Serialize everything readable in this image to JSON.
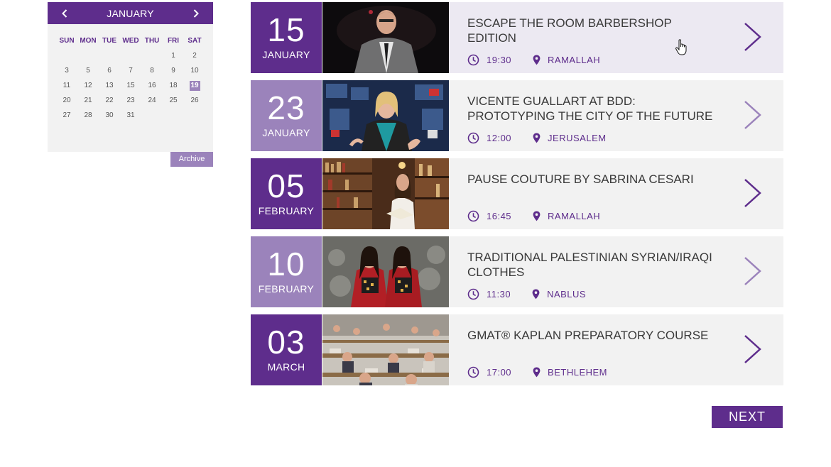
{
  "calendar": {
    "month": "JANUARY",
    "weekdays": [
      "SUN",
      "MON",
      "TUE",
      "WED",
      "THU",
      "FRI",
      "SAT"
    ],
    "days": [
      {
        "d": "",
        "t": ""
      },
      {
        "d": "",
        "t": ""
      },
      {
        "d": "",
        "t": ""
      },
      {
        "d": "",
        "t": ""
      },
      {
        "d": "",
        "t": ""
      },
      {
        "d": "1",
        "t": ""
      },
      {
        "d": "2",
        "t": ""
      },
      {
        "d": "3",
        "t": ""
      },
      {
        "d": "4",
        "t": "event"
      },
      {
        "d": "5",
        "t": ""
      },
      {
        "d": "6",
        "t": ""
      },
      {
        "d": "7",
        "t": ""
      },
      {
        "d": "8",
        "t": ""
      },
      {
        "d": "9",
        "t": ""
      },
      {
        "d": "10",
        "t": ""
      },
      {
        "d": "11",
        "t": ""
      },
      {
        "d": "12",
        "t": ""
      },
      {
        "d": "13",
        "t": ""
      },
      {
        "d": "14",
        "t": "event"
      },
      {
        "d": "15",
        "t": ""
      },
      {
        "d": "16",
        "t": ""
      },
      {
        "d": "17",
        "t": "event"
      },
      {
        "d": "18",
        "t": ""
      },
      {
        "d": "19",
        "t": "today"
      },
      {
        "d": "20",
        "t": ""
      },
      {
        "d": "21",
        "t": ""
      },
      {
        "d": "22",
        "t": ""
      },
      {
        "d": "23",
        "t": ""
      },
      {
        "d": "24",
        "t": ""
      },
      {
        "d": "25",
        "t": ""
      },
      {
        "d": "26",
        "t": ""
      },
      {
        "d": "27",
        "t": ""
      },
      {
        "d": "28",
        "t": ""
      },
      {
        "d": "29",
        "t": "event"
      },
      {
        "d": "30",
        "t": ""
      },
      {
        "d": "31",
        "t": ""
      }
    ],
    "archive_label": "Archive"
  },
  "events": [
    {
      "day": "15",
      "month": "JANUARY",
      "title": "ESCAPE THE ROOM BARBERSHOP EDITION",
      "time": "19:30",
      "city": "RAMALLAH",
      "date_style": "dark",
      "image": "speaker-man-icon"
    },
    {
      "day": "23",
      "month": "JANUARY",
      "title": "VICENTE GUALLART AT BDD: PROTOTYPING THE CITY OF THE FUTURE",
      "time": "12:00",
      "city": "JERUSALEM",
      "date_style": "light",
      "image": "speaker-woman-icon"
    },
    {
      "day": "05",
      "month": "FEBRUARY",
      "title": "PAUSE COUTURE BY SABRINA CESARI",
      "time": "16:45",
      "city": "RAMALLAH",
      "date_style": "dark",
      "image": "bookshop-reader-icon"
    },
    {
      "day": "10",
      "month": "FEBRUARY",
      "title": "TRADITIONAL PALESTINIAN SYRIAN/IRAQI CLOTHES",
      "time": "11:30",
      "city": "NABLUS",
      "date_style": "light",
      "image": "embroidered-dresses-icon"
    },
    {
      "day": "03",
      "month": "MARCH",
      "title": "GMAT® KAPLAN PREPARATORY COURSE",
      "time": "17:00",
      "city": "BETHLEHEM",
      "date_style": "dark",
      "image": "exam-room-icon"
    }
  ],
  "next_label": "NEXT",
  "colors": {
    "primary": "#5e2d8c",
    "secondary": "#9b83bb",
    "panel": "#f2f2f2",
    "active_panel": "#ece9f2"
  }
}
